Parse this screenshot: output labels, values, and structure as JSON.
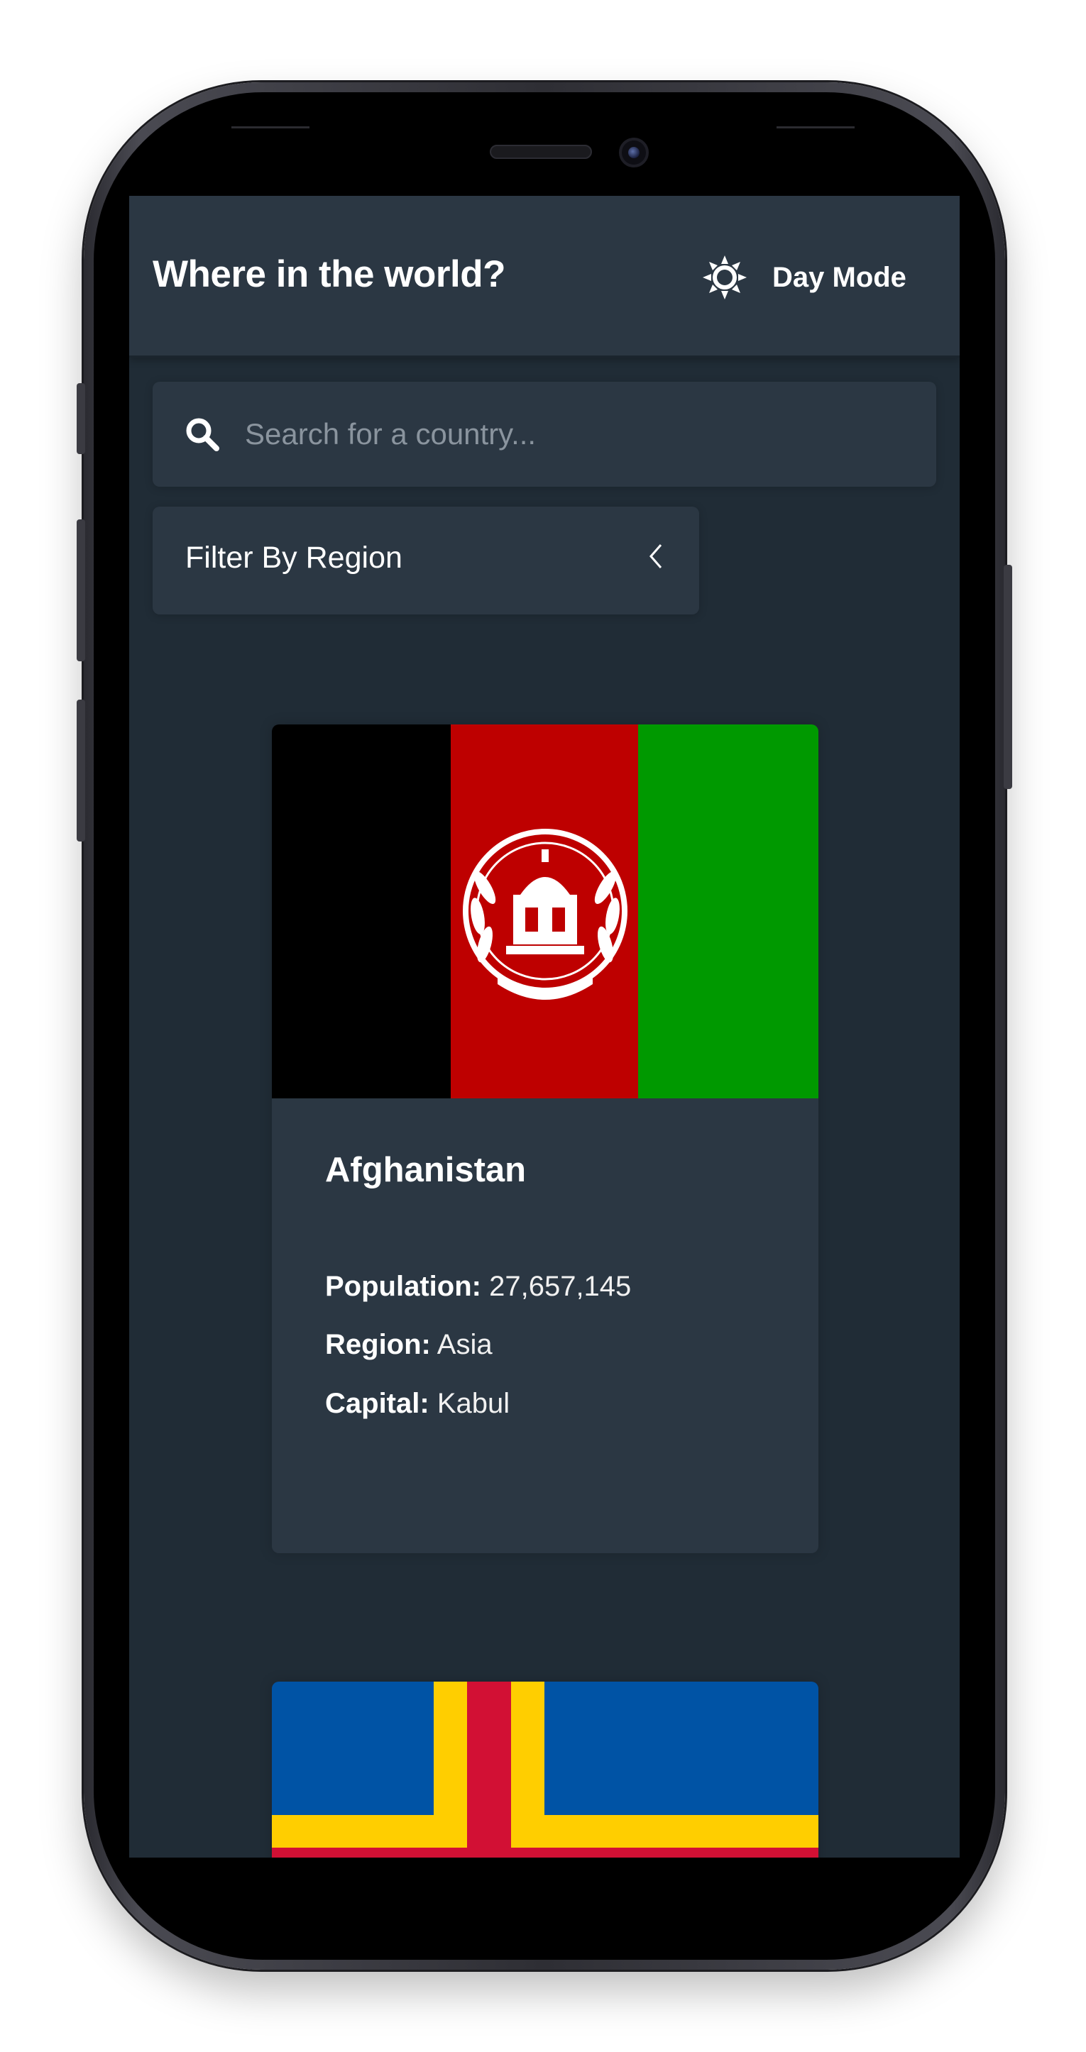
{
  "header": {
    "title": "Where in the world?",
    "mode_label": "Day Mode",
    "mode_icon": "sun-icon"
  },
  "search": {
    "placeholder": "Search for a country...",
    "icon": "search-icon"
  },
  "filter": {
    "label": "Filter By Region",
    "icon": "chevron-left-icon"
  },
  "countries": [
    {
      "name": "Afghanistan",
      "population_label": "Population:",
      "population": "27,657,145",
      "region_label": "Region:",
      "region": "Asia",
      "capital_label": "Capital:",
      "capital": "Kabul",
      "flag_colors": [
        "#000000",
        "#be0000",
        "#009900"
      ]
    },
    {
      "flag_colors": [
        "#0053a5",
        "#ffce00",
        "#d21034"
      ]
    }
  ],
  "colors": {
    "background": "#202c36",
    "element": "#2b3743",
    "text": "#ffffff"
  }
}
